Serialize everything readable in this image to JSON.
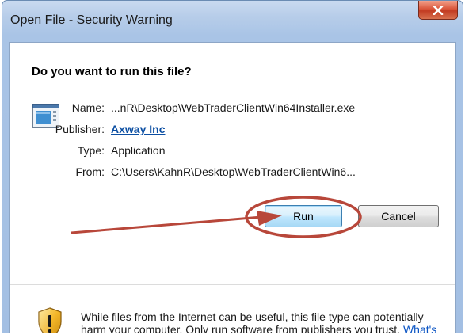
{
  "window": {
    "title": "Open File - Security Warning"
  },
  "dialog": {
    "question": "Do you want to run this file?",
    "fields": [
      {
        "label": "Name:",
        "value": "...nR\\Desktop\\WebTraderClientWin64Installer.exe"
      },
      {
        "label": "Publisher:",
        "value": "Axway Inc"
      },
      {
        "label": "Type:",
        "value": "Application"
      },
      {
        "label": "From:",
        "value": "C:\\Users\\KahnR\\Desktop\\WebTraderClientWin6..."
      }
    ],
    "buttons": {
      "run": "Run",
      "cancel": "Cancel"
    },
    "warning": {
      "text": "While files from the Internet can be useful, this file type can potentially harm your computer. Only run software from publishers you trust.",
      "link": "What's the risk?"
    }
  },
  "colors": {
    "title_bar": "#a9c4e6",
    "close_button": "#c23b22",
    "annotation": "#b8473a",
    "link": "#0b4ea2"
  },
  "icons": [
    "close-icon",
    "application-icon",
    "shield-warning-icon"
  ]
}
